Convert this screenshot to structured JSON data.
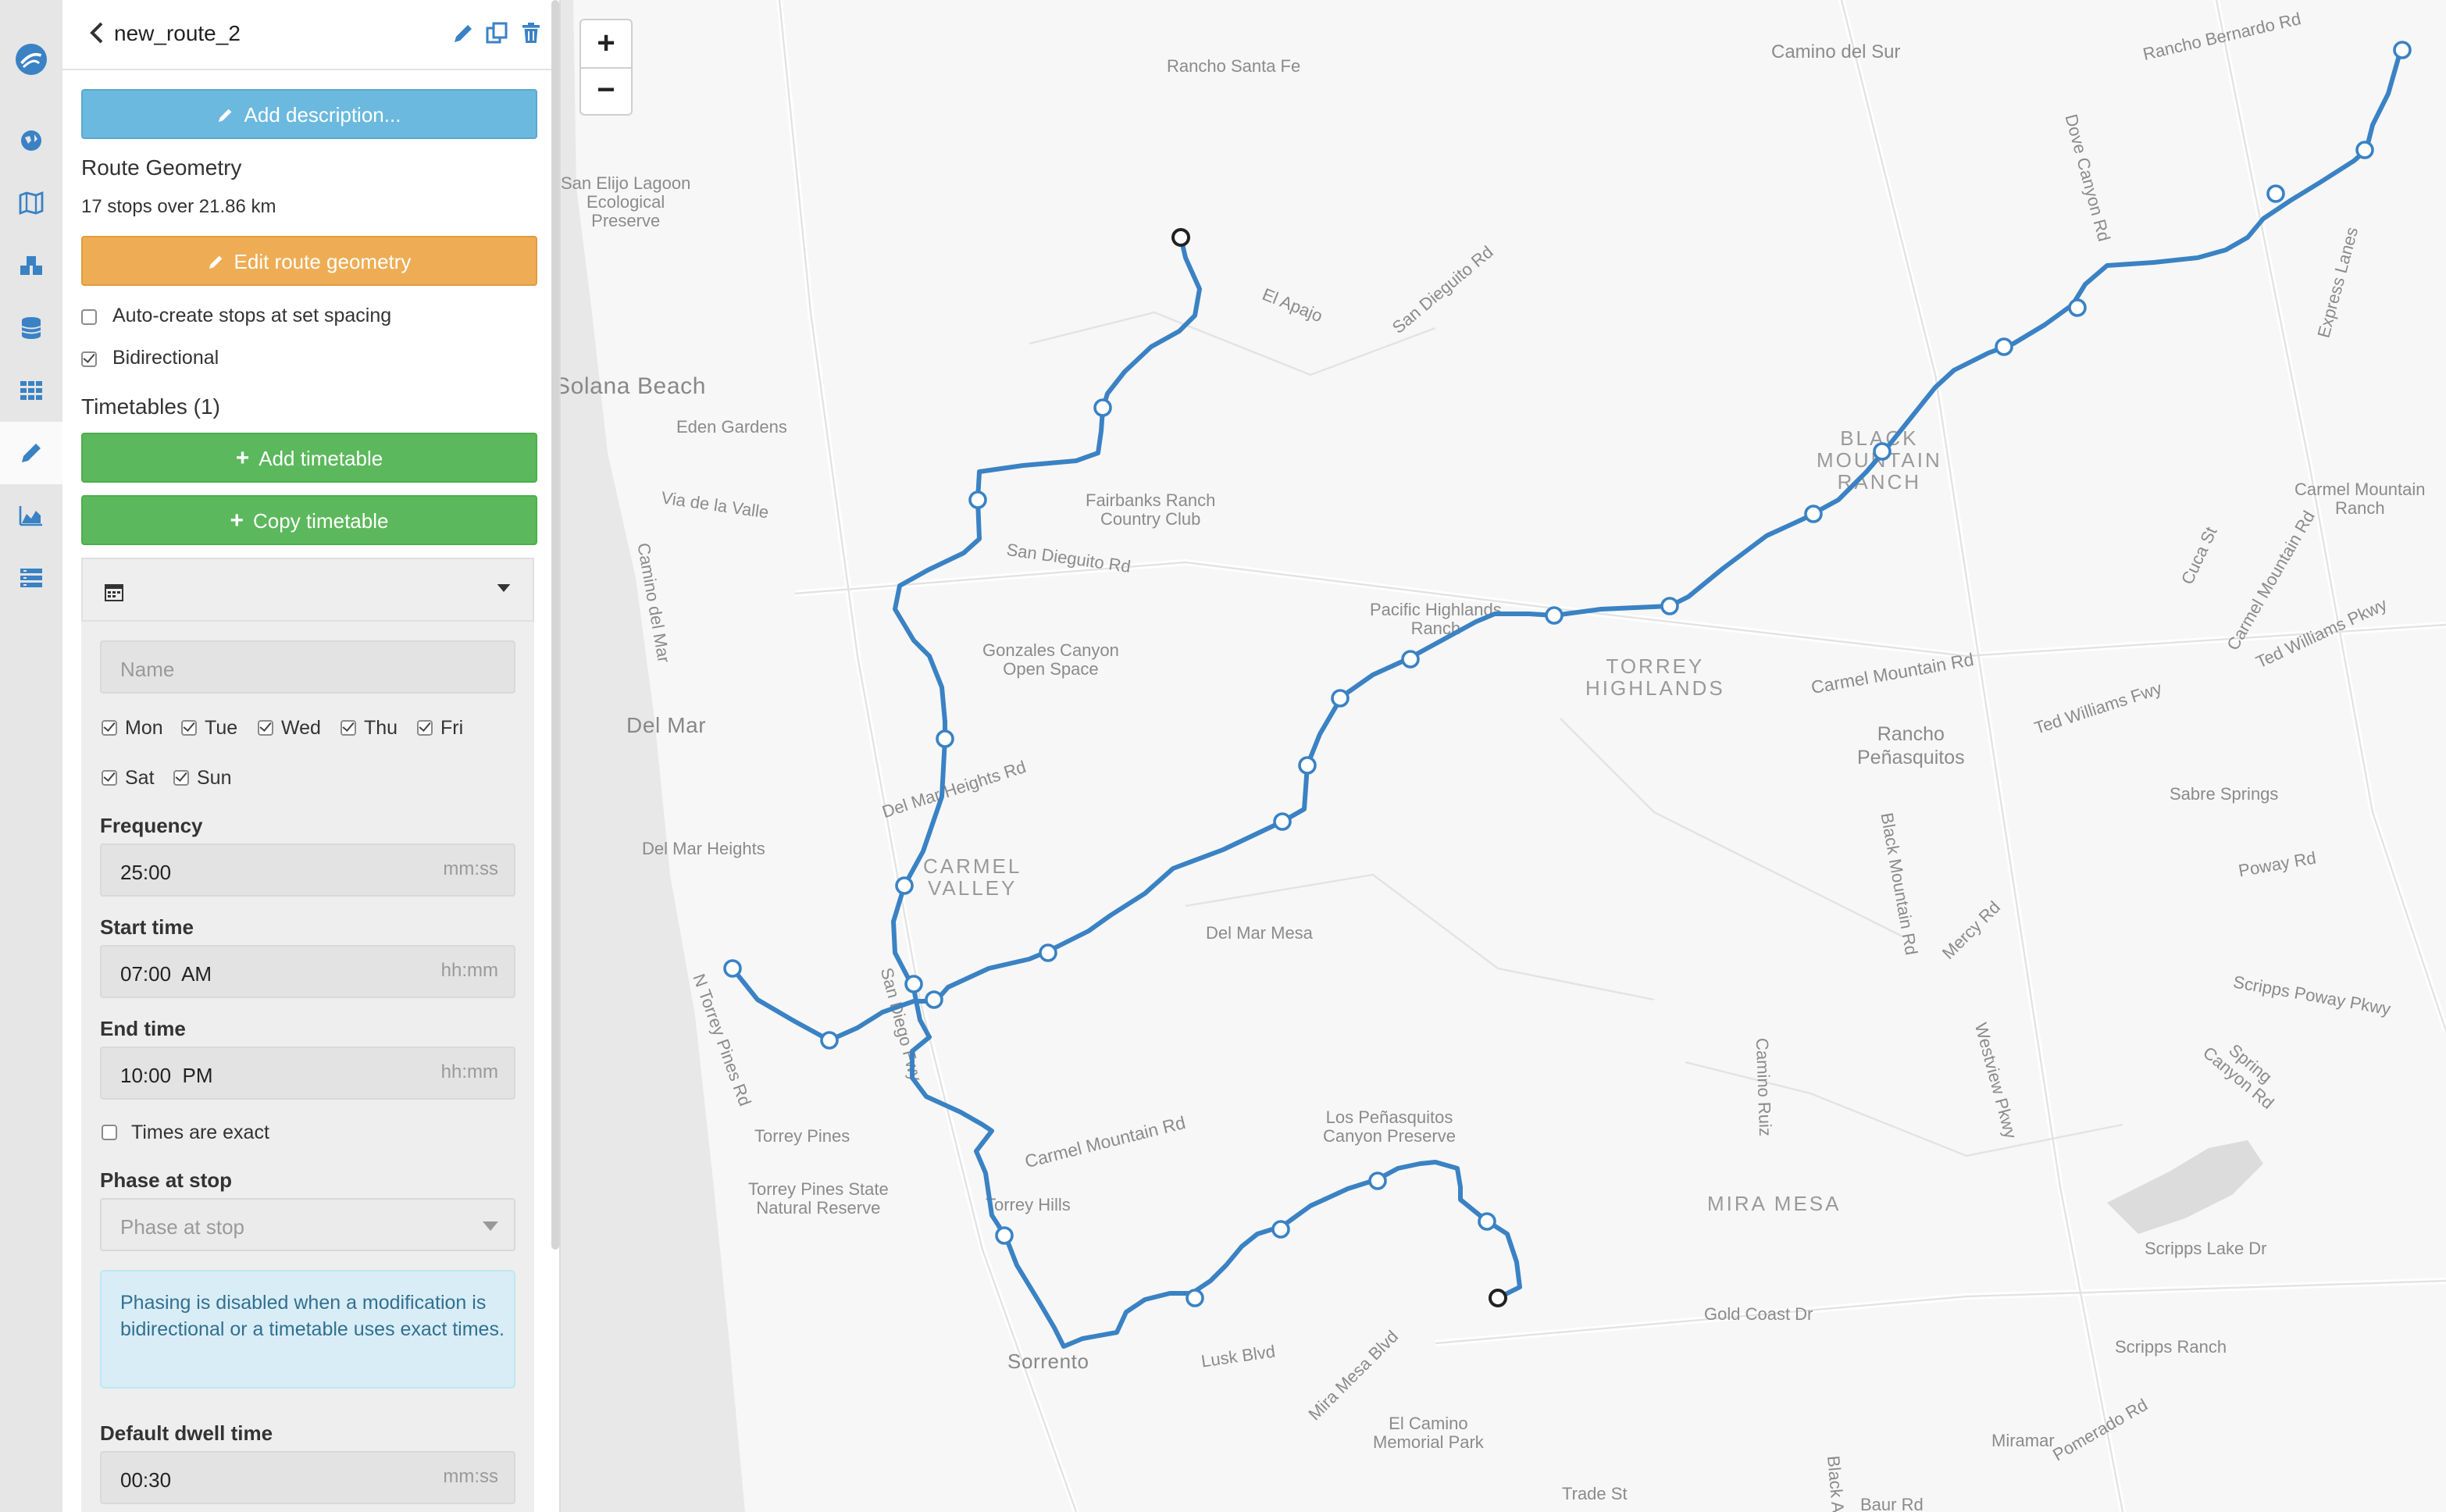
{
  "route": {
    "name": "new_route_2",
    "add_description": "Add description...",
    "section_title": "Route Geometry",
    "stops_summary": "17 stops over 21.86 km",
    "edit_geometry": "Edit route geometry",
    "auto_create": "Auto-create stops at set spacing",
    "bidirectional": "Bidirectional"
  },
  "timetables": {
    "heading": "Timetables (1)",
    "add": "Add timetable",
    "copy": "Copy timetable",
    "name_placeholder": "Name",
    "days": [
      "Mon",
      "Tue",
      "Wed",
      "Thu",
      "Fri",
      "Sat",
      "Sun"
    ],
    "frequency_label": "Frequency",
    "frequency_value": "25:00",
    "frequency_unit": "mm:ss",
    "start_label": "Start time",
    "start_value": "07:00  AM",
    "start_unit": "hh:mm",
    "end_label": "End time",
    "end_value": "10:00  PM",
    "end_unit": "hh:mm",
    "exact_label": "Times are exact",
    "phase_label": "Phase at stop",
    "phase_placeholder": "Phase at stop",
    "phase_notice": "Phasing is disabled when a modification is bidirectional or a timetable uses exact times.",
    "dwell_label": "Default dwell time",
    "dwell_value": "00:30",
    "dwell_unit": "mm:ss"
  },
  "map": {
    "zoom_in": "+",
    "zoom_out": "−",
    "places": {
      "rancho_santa_fe": "Rancho Santa Fe",
      "camino_del_sur": "Camino del Sur",
      "rancho_bernardo_rd": "Rancho Bernardo Rd",
      "san_elijo": "San Elijo Lagoon\nEcological\nPreserve",
      "el_apajo": "El Apajo",
      "san_dieguito_rd_n": "San Dieguito Rd",
      "dove_canyon_rd": "Dove Canyon Rd",
      "express_lanes": "Express Lanes",
      "solana_beach": "Solana Beach",
      "eden_gardens": "Eden Gardens",
      "black_mountain_ranch": "BLACK\nMOUNTAIN\nRANCH",
      "via_de_la_valle": "Via de la Valle",
      "fairbanks": "Fairbanks Ranch\nCountry Club",
      "san_dieguito_rd_s": "San Dieguito Rd",
      "carmel_mountain_ranch": "Carmel Mountain\nRanch",
      "camino_del_mar": "Camino del Mar",
      "pacific_highlands": "Pacific Highlands\nRanch",
      "gonzales": "Gonzales Canyon\nOpen Space",
      "torrey_highlands": "TORREY\nHIGHLANDS",
      "carmel_mountain_rd_n": "Carmel Mountain Rd",
      "del_mar": "Del Mar",
      "rancho_penasquitos": "Rancho\nPeñasquitos",
      "ted_williams_fwy": "Ted Williams Fwy",
      "ted_williams_pkwy": "Ted Williams Pkwy",
      "del_mar_heights_rd": "Del Mar Heights Rd",
      "carmel_valley": "CARMEL\nVALLEY",
      "del_mar_heights": "Del Mar Heights",
      "sabre_springs": "Sabre Springs",
      "black_mountain_rd": "Black Mountain Rd",
      "poway_rd": "Poway Rd",
      "del_mar_mesa": "Del Mar Mesa",
      "mercy_rd": "Mercy Rd",
      "n_torrey_pines_rd": "N Torrey Pines Rd",
      "san_diego_fwy": "San Diego Fwy",
      "scripps_poway_pkwy": "Scripps Poway Pkwy",
      "camino_ruiz": "Camino Ruiz",
      "westview_pkwy": "Westview Pkwy",
      "spring_canyon_rd": "Spring\nCanyon Rd",
      "torrey_pines": "Torrey Pines",
      "carmel_mountain_rd_s": "Carmel Mountain Rd",
      "los_penasquitos": "Los Peñasquitos\nCanyon Preserve",
      "torrey_pines_state": "Torrey Pines State\nNatural Reserve",
      "torrey_hills": "Torrey Hills",
      "mira_mesa": "MIRA MESA",
      "scripps_lake_dr": "Scripps Lake Dr",
      "gold_coast_dr": "Gold Coast Dr",
      "lusk_blvd": "Lusk Blvd",
      "mira_mesa_blvd": "Mira Mesa Blvd",
      "sorrento": "Sorrento",
      "scripps_ranch": "Scripps Ranch",
      "el_camino": "El Camino\nMemorial Park",
      "miramar": "Miramar",
      "pomerado_rd": "Pomerado Rd",
      "trade_st": "Trade St",
      "black_ave": "Black Ave",
      "baur_rd": "Baur Rd",
      "cuca_st": "Cuca St"
    }
  },
  "colors": {
    "route": "#3a82c4",
    "blue_button": "#6bb9de",
    "orange_button": "#eead55",
    "green_button": "#5cb85c",
    "notice_bg": "#d9edf7",
    "notice_text": "#31708f"
  }
}
